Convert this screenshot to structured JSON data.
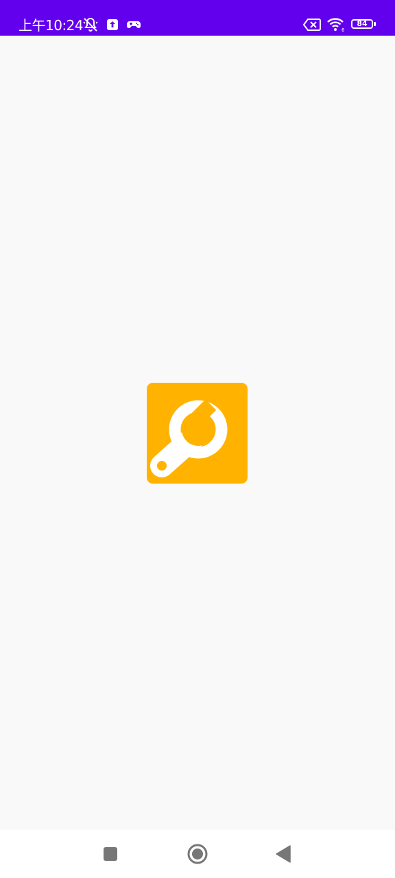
{
  "status_bar": {
    "time": "上午10:24",
    "battery_level": "84",
    "background_color": "#6200ee",
    "left_icons": [
      "muted-bell-icon",
      "upload-icon",
      "gamepad-icon"
    ],
    "right_icons": [
      "sim-error-icon",
      "wifi-icon",
      "battery-icon"
    ]
  },
  "app": {
    "logo_icon": "wrench-icon",
    "logo_color": "#ffb300"
  },
  "navigation_bar": {
    "buttons": [
      "recent-apps-icon",
      "home-icon",
      "back-icon"
    ]
  }
}
